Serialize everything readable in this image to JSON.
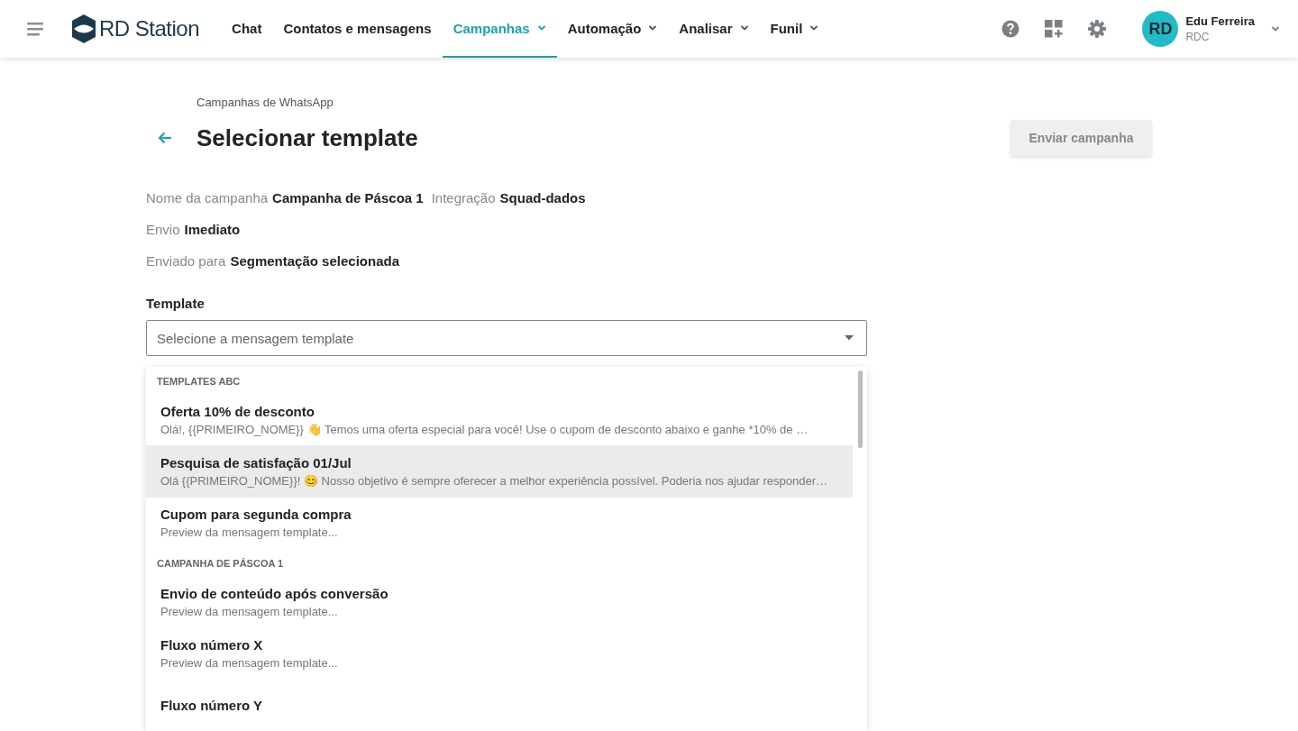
{
  "header": {
    "logo_text": "RD Station",
    "nav": [
      {
        "label": "Chat",
        "selected": false,
        "dropdown": false
      },
      {
        "label": "Contatos e mensagens",
        "selected": false,
        "dropdown": false
      },
      {
        "label": "Campanhas",
        "selected": true,
        "dropdown": true
      },
      {
        "label": "Automação",
        "selected": false,
        "dropdown": true
      },
      {
        "label": "Analisar",
        "selected": false,
        "dropdown": true
      },
      {
        "label": "Funil",
        "selected": false,
        "dropdown": true
      }
    ],
    "user": {
      "initials": "RD",
      "name": "Edu Ferreira",
      "company": "RDC"
    }
  },
  "breadcrumb": "Campanhas de WhatsApp",
  "title": "Selecionar template",
  "send_button": {
    "label": "Enviar campanha",
    "disabled": true
  },
  "info": [
    [
      {
        "label": "Nome da campanha",
        "value": "Campanha de Páscoa 1"
      },
      {
        "label": "Integração",
        "value": "Squad-dados"
      }
    ],
    [
      {
        "label": "Envio",
        "value": "Imediato"
      }
    ],
    [
      {
        "label": "Enviado para",
        "value": "Segmentação selecionada"
      }
    ]
  ],
  "template_field": {
    "label": "Template",
    "placeholder": "Selecione a mensagem template"
  },
  "dropdown_groups": [
    {
      "name": "TEMPLATES ABC",
      "items": [
        {
          "title": "Oferta 10% de desconto",
          "preview": "Olá!, {{PRIMEIRO_NOME}} 👋 Temos uma oferta especial para você! Use o cupom de desconto abaixo e ganhe *10% de …",
          "selected": false
        },
        {
          "title": "Pesquisa de satisfação 01/Jul",
          "preview": "Olá {{PRIMEIRO_NOME}}! 😊 Nosso objetivo é sempre oferecer a melhor experiência possível. Poderia nos ajudar responder…",
          "selected": true
        },
        {
          "title": "Cupom para segunda compra",
          "preview": "Preview da mensagem template...",
          "selected": false
        }
      ]
    },
    {
      "name": "CAMPANHA DE PÁSCOA 1",
      "items": [
        {
          "title": "Envio de conteúdo após conversão",
          "preview": "Preview da mensagem template...",
          "selected": false
        },
        {
          "title": "Fluxo número X",
          "preview": "Preview da mensagem template...",
          "selected": false
        },
        {
          "title": "Fluxo número Y",
          "selected": false
        }
      ]
    }
  ]
}
